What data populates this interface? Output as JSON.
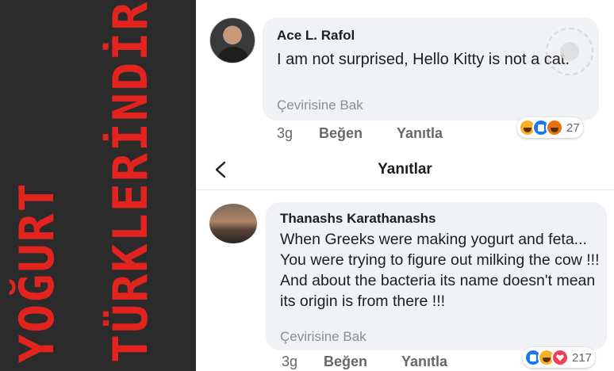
{
  "banner": {
    "line1": "YOĞURT",
    "line2": "TÜRKLERİNDİR"
  },
  "comment": {
    "author": "Ace L. Rafol",
    "text": "I am not surprised, Hello Kitty is not a cat.",
    "translate_label": "Çevirisine Bak",
    "time": "3g",
    "like_label": "Beğen",
    "reply_label": "Yanıtla",
    "reactions": [
      "haha",
      "like",
      "angry"
    ],
    "reaction_count": "27"
  },
  "replies_header": {
    "title": "Yanıtlar",
    "back_icon": "chevron-left-icon"
  },
  "reply": {
    "author": "Thanashs Karathanashs",
    "text": "When Greeks were making yogurt and feta... You were trying to figure out milking the cow !!! And about the bacteria its name doesn't mean its origin is from there !!!",
    "translate_label": "Çevirisine Bak",
    "time": "3g",
    "like_label": "Beğen",
    "reply_label": "Yanıtla",
    "reactions": [
      "like",
      "haha",
      "love"
    ],
    "reaction_count": "217"
  },
  "colors": {
    "banner_bg": "#2b2b2b",
    "banner_text": "#e3241e",
    "bubble_bg": "#f0f2f5",
    "like_blue": "#1877f2"
  }
}
